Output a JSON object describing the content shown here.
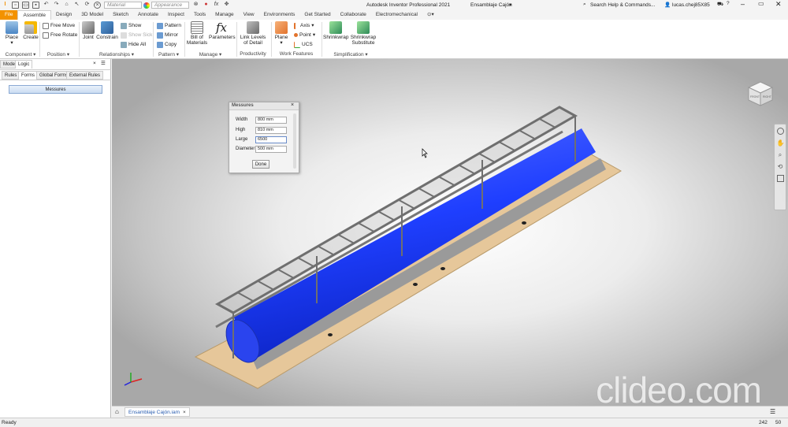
{
  "app": {
    "title": "Autodesk Inventor Professional 2021",
    "document": "Ensamblaje Cajón",
    "material_placeholder": "Material",
    "appearance_placeholder": "Appearance",
    "search_placeholder": "Search Help & Commands...",
    "user": "lucas.chej85X85"
  },
  "ribbon_tabs": [
    "File",
    "Assemble",
    "Design",
    "3D Model",
    "Sketch",
    "Annotate",
    "Inspect",
    "Tools",
    "Manage",
    "View",
    "Environments",
    "Get Started",
    "Collaborate",
    "Electromechanical"
  ],
  "ribbon": {
    "component": {
      "title": "Component ▾",
      "place": "Place",
      "create": "Create"
    },
    "position": {
      "title": "Position ▾",
      "free_move": "Free Move",
      "free_rotate": "Free Rotate"
    },
    "relationships": {
      "title": "Relationships ▾",
      "joint": "Joint",
      "constrain": "Constrain",
      "show": "Show",
      "show_sick": "Show Sick",
      "hide_all": "Hide All"
    },
    "pattern": {
      "title": "Pattern ▾",
      "pattern": "Pattern",
      "mirror": "Mirror",
      "copy": "Copy"
    },
    "manage": {
      "title": "Manage ▾",
      "bom": "Bill of Materials",
      "parameters": "Parameters"
    },
    "productivity": {
      "title": "Productivity",
      "link_levels": "Link Levels of Detail"
    },
    "work_features": {
      "title": "Work Features",
      "plane": "Plane",
      "axis": "Axis",
      "point": "Point",
      "ucs": "UCS"
    },
    "simplification": {
      "title": "Simplification ▾",
      "shrinkwrap": "Shrinkwrap",
      "shrinkwrap_sub": "Shrinkwrap Substitute"
    }
  },
  "left_panel": {
    "top_tabs": [
      "Model",
      "Logic"
    ],
    "sub_tabs": [
      "Rules",
      "Forms",
      "Global Forms",
      "External Rules"
    ],
    "item": "Messures"
  },
  "dialog": {
    "title": "Messures",
    "fields": [
      {
        "label": "Width",
        "value": "800 mm"
      },
      {
        "label": "High",
        "value": "810 mm"
      },
      {
        "label": "Large",
        "value": "6500"
      },
      {
        "label": "Diameter",
        "value": "500 mm"
      }
    ],
    "done": "Done"
  },
  "view_cube": {
    "front": "FRONT",
    "right": "RIGHT"
  },
  "doc_tab": "Ensamblaje Cajón.iam",
  "status": {
    "left": "Ready",
    "n1": "242",
    "n2": "50"
  },
  "watermark": "clideo.com",
  "colors": {
    "accent": "#f39200",
    "cylinder": "#1f3fff",
    "floor": "#e6c79a",
    "frame": "#8a8a8a"
  }
}
